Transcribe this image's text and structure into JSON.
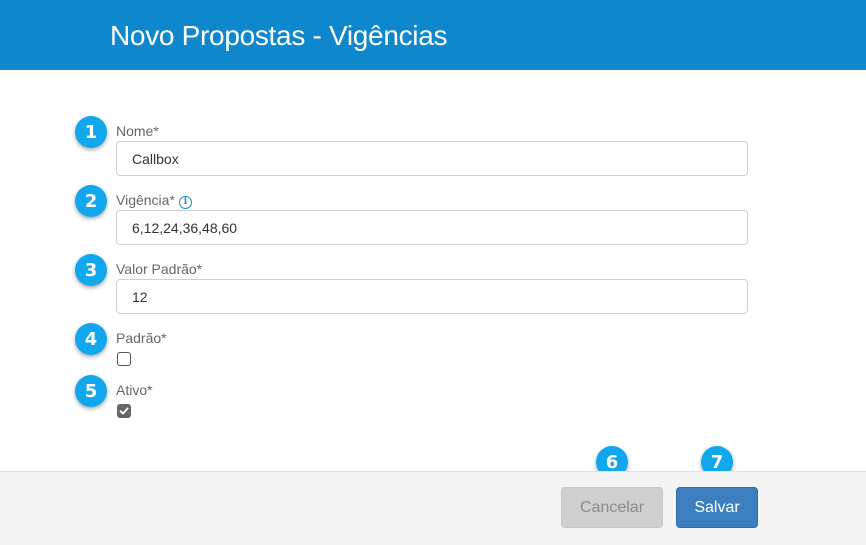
{
  "header": {
    "title": "Novo Propostas - Vigências",
    "background": "#0f87cc"
  },
  "badges": [
    "1",
    "2",
    "3",
    "4",
    "5",
    "6",
    "7"
  ],
  "form": {
    "nome": {
      "label": "Nome*",
      "value": "Callbox"
    },
    "vigencia": {
      "label": "Vigência*",
      "value": "6,12,24,36,48,60",
      "info_icon": "info-icon"
    },
    "valor_padrao": {
      "label": "Valor Padrão*",
      "value": "12"
    },
    "padrao": {
      "label": "Padrão*",
      "checked": false
    },
    "ativo": {
      "label": "Ativo*",
      "checked": true
    }
  },
  "footer": {
    "cancel_label": "Cancelar",
    "save_label": "Salvar",
    "save_color": "#3b7fc0"
  }
}
